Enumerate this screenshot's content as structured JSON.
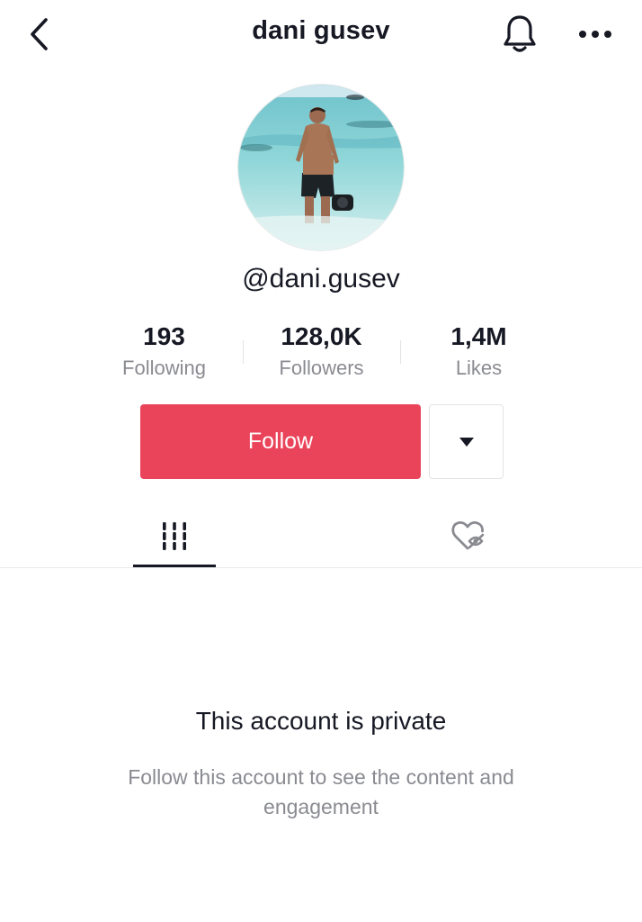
{
  "header": {
    "title": "dani gusev",
    "back_icon": "chevron-left-icon",
    "bell_icon": "bell-icon",
    "more_icon": "more-horizontal-icon"
  },
  "profile": {
    "username": "@dani.gusev",
    "avatar": "profile-photo"
  },
  "stats": [
    {
      "value": "193",
      "label": "Following"
    },
    {
      "value": "128,0K",
      "label": "Followers"
    },
    {
      "value": "1,4M",
      "label": "Likes"
    }
  ],
  "actions": {
    "follow_label": "Follow",
    "dropdown_icon": "caret-down-icon"
  },
  "tabs": [
    {
      "name": "videos",
      "icon": "grid-bars-icon",
      "active": true
    },
    {
      "name": "liked",
      "icon": "liked-hidden-icon",
      "active": false
    }
  ],
  "private": {
    "title": "This account is private",
    "subtitle": "Follow this account to see the content and engagement"
  },
  "colors": {
    "accent": "#ea445a",
    "text_primary": "#161823",
    "text_secondary": "#8a8b91",
    "divider": "#e3e3e4"
  }
}
